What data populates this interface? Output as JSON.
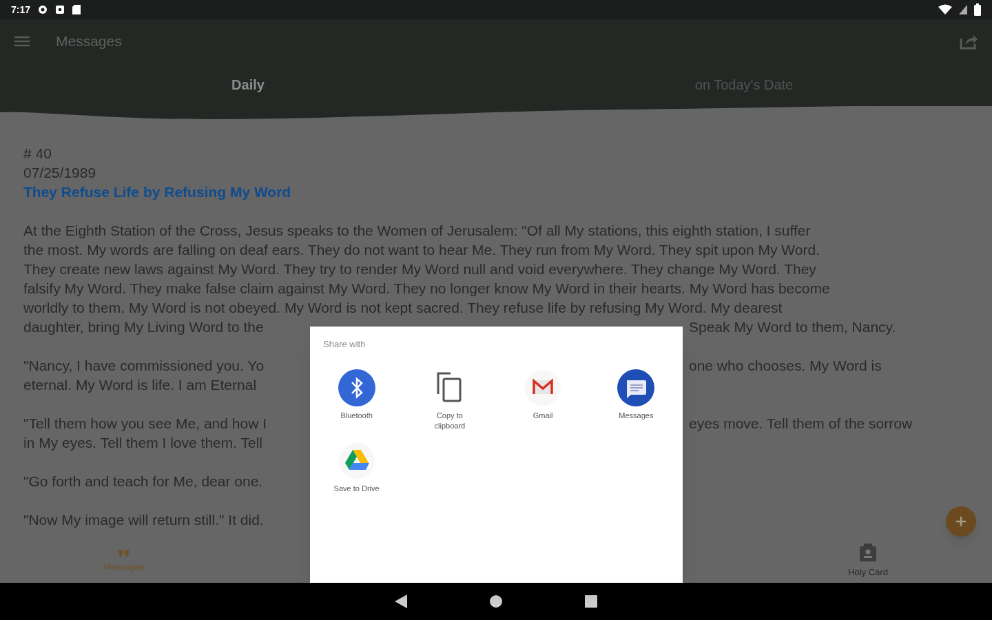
{
  "status_bar": {
    "time": "7:17"
  },
  "toolbar": {
    "title": "Messages"
  },
  "tabs": [
    {
      "label": "Daily",
      "selected": true
    },
    {
      "label": "on Today's Date",
      "selected": false
    }
  ],
  "message": {
    "number": "# 40",
    "date": "07/25/1989",
    "title": "They Refuse Life by Refusing My Word",
    "paragraphs": [
      {
        "lines": [
          {
            "left": "At the Eighth Station of the Cross, Jesus speaks to the Women of Jerusalem: \"Of all My stations, this eighth station, I suffer"
          },
          {
            "left": "the most. My words are falling on deaf ears. They do not want to hear Me. They run from My Word. They spit upon My Word."
          },
          {
            "left": "They create new laws against My Word. They try to render My Word null and void everywhere. They change My Word. They"
          },
          {
            "left": "falsify My Word. They make false claim against My Word. They no longer know My Word in their hearts. My Word has become"
          },
          {
            "left": "worldly to them. My Word is not obeyed. My Word is not kept sacred. They refuse life by refusing My Word. My dearest"
          },
          {
            "left": "daughter, bring My Living Word to the",
            "right": "Speak My Word to them, Nancy."
          }
        ]
      },
      {
        "lines": [
          {
            "left": "\"Nancy, I have commissioned you. Yo",
            "right": "one who chooses. My Word is"
          },
          {
            "left": "eternal. My Word is life. I am Eternal"
          }
        ]
      },
      {
        "lines": [
          {
            "left": "\"Tell them how you see Me, and how I",
            "right": "eyes move. Tell them of the sorrow"
          },
          {
            "left": "in My eyes. Tell them I love them. Tell"
          }
        ]
      },
      {
        "lines": [
          {
            "left": "\"Go forth and teach for Me, dear one."
          }
        ]
      },
      {
        "lines": [
          {
            "left": "\"Now My image will return still.\" It did."
          }
        ]
      }
    ]
  },
  "share_dialog": {
    "title": "Share with",
    "apps": [
      {
        "label": "Bluetooth",
        "kind": "bluetooth"
      },
      {
        "label": "Copy to clipboard",
        "kind": "copy"
      },
      {
        "label": "Gmail",
        "kind": "gmail"
      },
      {
        "label": "Messages",
        "kind": "messages"
      },
      {
        "label": "Save to Drive",
        "kind": "drive"
      }
    ]
  },
  "bottom_nav": [
    {
      "label": "Messages",
      "kind": "quote",
      "selected": true
    },
    {
      "label": "Holy Card",
      "kind": "card",
      "selected": false
    }
  ]
}
